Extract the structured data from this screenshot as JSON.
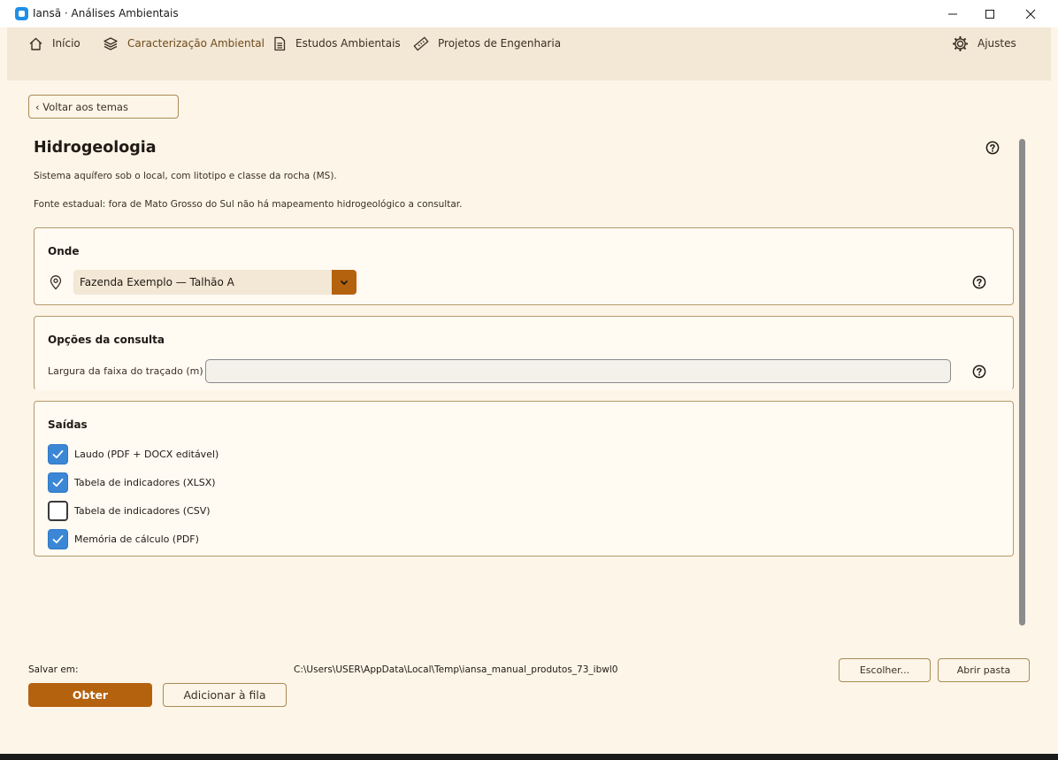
{
  "window": {
    "title": "Iansã · Análises Ambientais"
  },
  "nav": {
    "items": [
      {
        "label": "Início",
        "icon": "home-icon"
      },
      {
        "label": "Caracterização Ambiental",
        "icon": "layers-icon"
      },
      {
        "label": "Estudos Ambientais",
        "icon": "document-icon"
      },
      {
        "label": "Projetos de Engenharia",
        "icon": "ruler-icon"
      }
    ],
    "settings_label": "Ajustes"
  },
  "page": {
    "back_label": "‹ Voltar aos temas",
    "title": "Hidrogeologia",
    "description": "Sistema aquífero sob o local, com litotipo e classe da rocha (MS).",
    "source_note": "Fonte estadual: fora de Mato Grosso do Sul não há mapeamento hidrogeológico a consultar."
  },
  "where": {
    "title": "Onde",
    "selected_value": "Fazenda Exemplo — Talhão A"
  },
  "options": {
    "title": "Opções da consulta",
    "width_label": "Largura da faixa do traçado (m)",
    "width_value": ""
  },
  "outputs": {
    "title": "Saídas",
    "items": [
      {
        "label": "Laudo (PDF + DOCX editável)",
        "checked": true
      },
      {
        "label": "Tabela de indicadores (XLSX)",
        "checked": true
      },
      {
        "label": "Tabela de indicadores (CSV)",
        "checked": false
      },
      {
        "label": "Memória de cálculo (PDF)",
        "checked": true
      }
    ]
  },
  "footer": {
    "save_label": "Salvar em:",
    "save_path": "C:\\Users\\USER\\AppData\\Local\\Temp\\iansa_manual_produtos_73_ibwl0",
    "choose_label": "Escolher...",
    "open_folder_label": "Abrir pasta",
    "obtain_label": "Obter",
    "queue_label": "Adicionar à fila"
  },
  "colors": {
    "accent": "#b5620f",
    "background": "#fdf5e8",
    "nav_background": "#f3e7d5",
    "checkbox_on": "#3b87d6"
  }
}
